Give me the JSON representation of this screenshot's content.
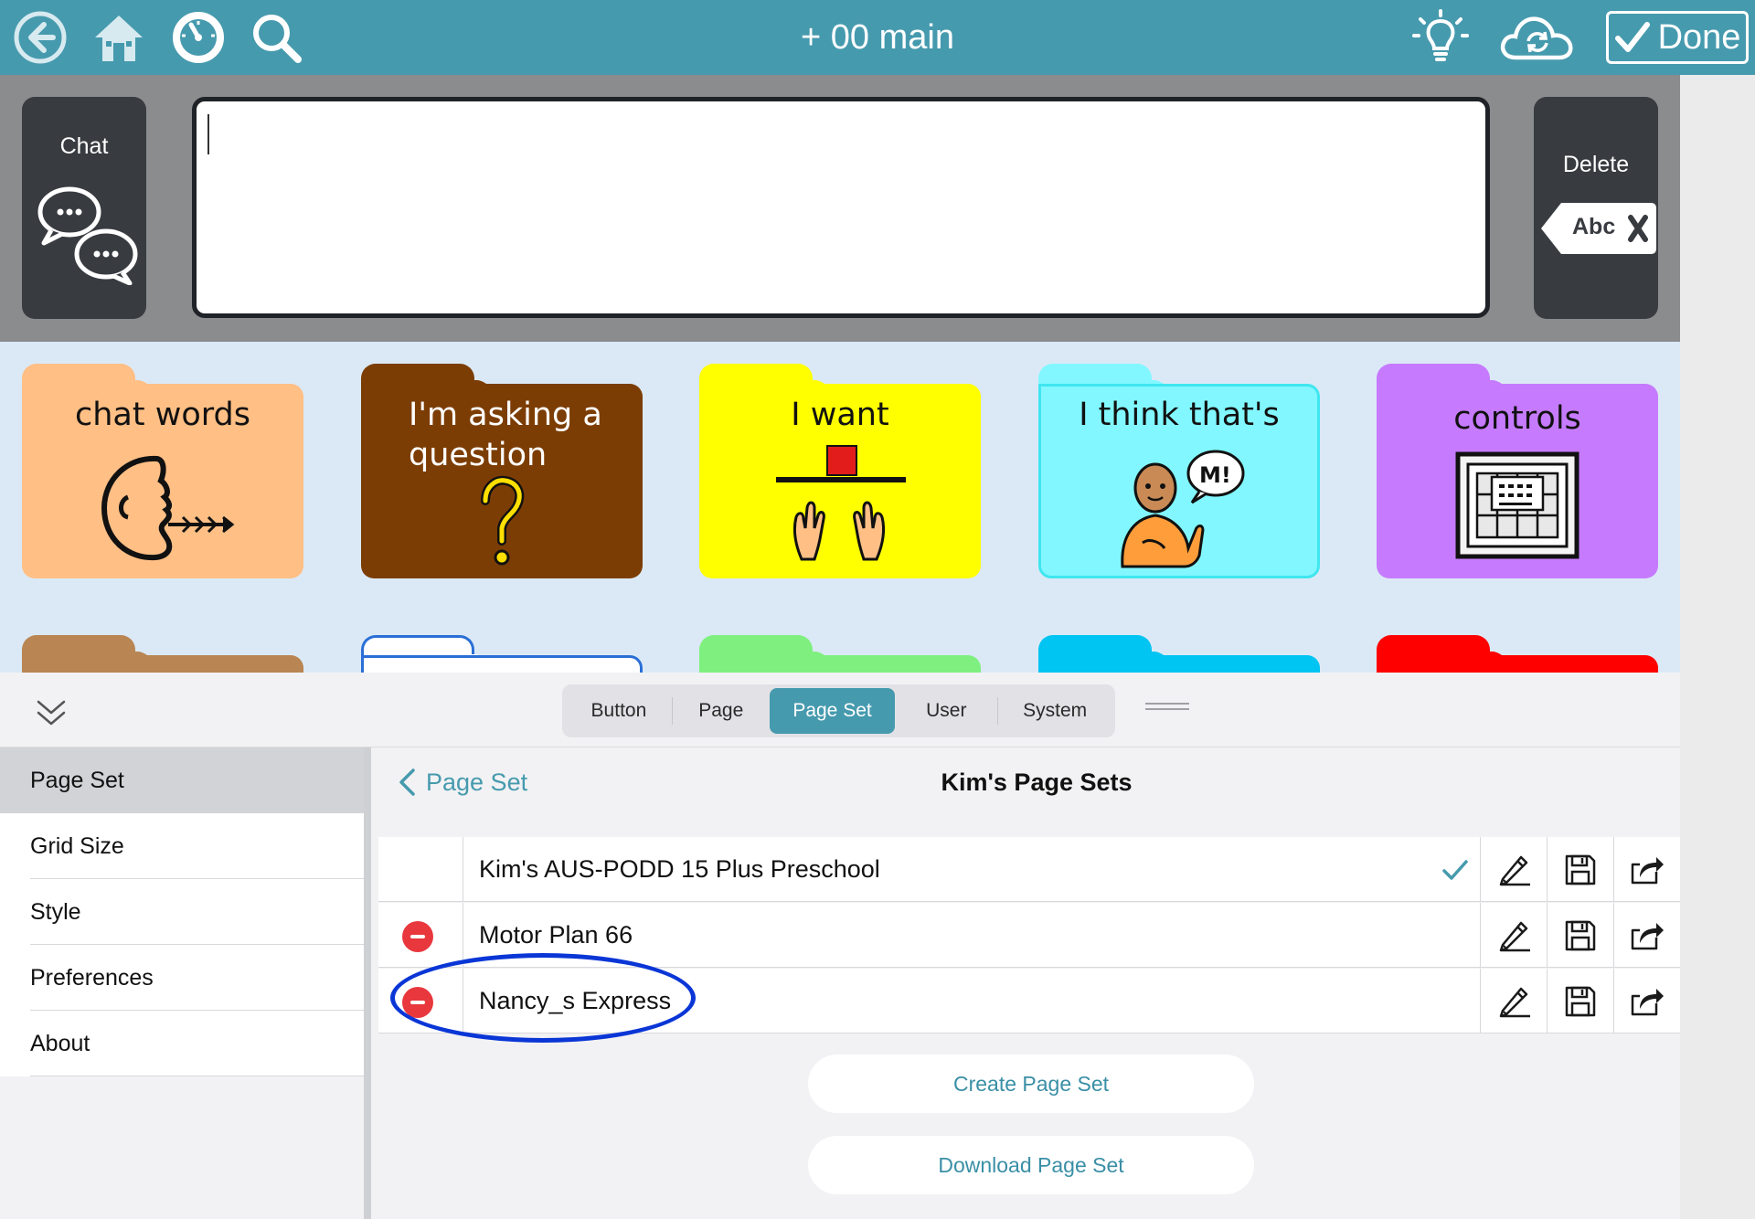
{
  "app": {
    "title": "+ 00 main",
    "done_label": "Done"
  },
  "message_area": {
    "chat_label": "Chat",
    "delete_label": "Delete",
    "delete_icon_text": "Abc"
  },
  "grid": {
    "folders": [
      {
        "label": "chat words",
        "color": "#ffbf85",
        "text_color": "#111111",
        "icon": "speaking-face-icon"
      },
      {
        "label": "I'm asking a question",
        "color": "#7c3d04",
        "text_color": "#ffffff",
        "icon": "question-mark-icon"
      },
      {
        "label": "I want",
        "color": "#ffff00",
        "text_color": "#111111",
        "icon": "want-hands-icon"
      },
      {
        "label": "I think that's",
        "color": "#82f7ff",
        "text_color": "#111111",
        "icon": "person-thinking-icon"
      },
      {
        "label": "controls",
        "color": "#c67bff",
        "text_color": "#111111",
        "icon": "controls-grid-icon"
      }
    ],
    "partial_folder_colors": [
      "#b98552",
      "#ffffff",
      "#7ff07f",
      "#00c4f2",
      "#ff0000"
    ]
  },
  "panel": {
    "tabs": [
      {
        "label": "Button",
        "active": false
      },
      {
        "label": "Page",
        "active": false
      },
      {
        "label": "Page Set",
        "active": true
      },
      {
        "label": "User",
        "active": false
      },
      {
        "label": "System",
        "active": false
      }
    ],
    "sidebar": [
      {
        "label": "Page Set",
        "selected": true
      },
      {
        "label": "Grid Size",
        "selected": false
      },
      {
        "label": "Style",
        "selected": false
      },
      {
        "label": "Preferences",
        "selected": false
      },
      {
        "label": "About",
        "selected": false
      }
    ],
    "back_label": "Page Set",
    "title": "Kim's Page Sets",
    "page_sets": [
      {
        "name": "Kim's AUS-PODD 15 Plus Preschool",
        "active": true,
        "deletable": false
      },
      {
        "name": "Motor Plan 66",
        "active": false,
        "deletable": true
      },
      {
        "name": "Nancy_s Express",
        "active": false,
        "deletable": true
      }
    ],
    "create_label": "Create Page Set",
    "download_label": "Download Page Set"
  },
  "colors": {
    "accent": "#469aae",
    "highlight_ring": "#0a36d6",
    "delete_red": "#e8373d"
  }
}
